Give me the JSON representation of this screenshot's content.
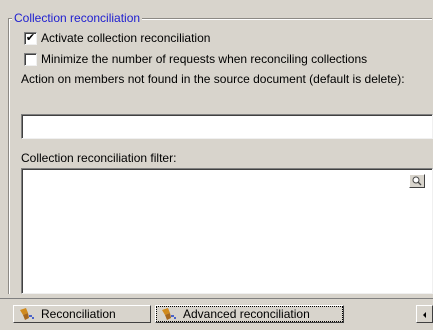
{
  "group": {
    "title": "Collection reconciliation"
  },
  "options": {
    "activate_label": "Activate collection reconciliation",
    "activate_checked_mark": "✔",
    "minimize_label": "Minimize the number of requests when reconciling collections",
    "minimize_checked_mark": ""
  },
  "action": {
    "label": "Action on members not found in the source document (default is delete):",
    "value": ""
  },
  "filter": {
    "label": "Collection reconciliation filter:",
    "value": "",
    "zoom_icon": "magnifier-icon"
  },
  "tabs": [
    {
      "label": "Reconciliation",
      "icon": "reconciliation-icon",
      "active": false
    },
    {
      "label": "Advanced reconciliation",
      "icon": "reconciliation-icon",
      "active": true
    }
  ],
  "tab_scroll_icon": "scroll-left-icon",
  "colors": {
    "window_bg": "#d8d4cc",
    "group_title": "#2020d0",
    "icon_primary": "#d08a1d",
    "icon_secondary": "#4b63c8"
  }
}
